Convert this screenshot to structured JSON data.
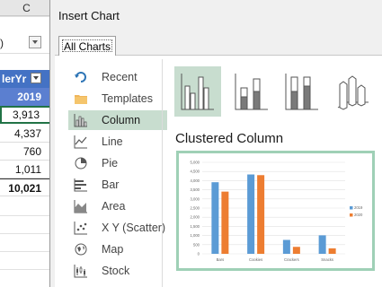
{
  "sheet": {
    "column_letter": "C",
    "filter_label": ")",
    "header_label": "lerYr",
    "year_label": "2019",
    "values": [
      "3,913",
      "4,337",
      "760",
      "1,011"
    ],
    "total": "10,021"
  },
  "dialog": {
    "title": "Insert Chart",
    "tab_label": "All Charts",
    "chart_types": [
      {
        "label": "Recent",
        "icon": "recent-icon"
      },
      {
        "label": "Templates",
        "icon": "folder-icon"
      },
      {
        "label": "Column",
        "icon": "column-chart-icon"
      },
      {
        "label": "Line",
        "icon": "line-chart-icon"
      },
      {
        "label": "Pie",
        "icon": "pie-chart-icon"
      },
      {
        "label": "Bar",
        "icon": "bar-chart-icon"
      },
      {
        "label": "Area",
        "icon": "area-chart-icon"
      },
      {
        "label": "X Y (Scatter)",
        "icon": "scatter-chart-icon"
      },
      {
        "label": "Map",
        "icon": "map-icon"
      },
      {
        "label": "Stock",
        "icon": "stock-chart-icon"
      }
    ],
    "selected_type": "Column",
    "subtypes": [
      "clustered-column",
      "stacked-column",
      "100-stacked-column",
      "3d-column"
    ],
    "selected_subtype_label": "Clustered Column",
    "accent_color": "#c8ddcf"
  },
  "chart_data": {
    "type": "bar",
    "categories": [
      "Bars",
      "Cookies",
      "Crackers",
      "Snacks"
    ],
    "series": [
      {
        "name": "2019",
        "values": [
          3913,
          4337,
          760,
          1011
        ],
        "color": "#5b9bd5"
      },
      {
        "name": "2020",
        "values": [
          3400,
          4300,
          380,
          300
        ],
        "color": "#ed7d31"
      }
    ],
    "yticks": [
      "0",
      "500",
      "1,000",
      "1,500",
      "2,000",
      "2,500",
      "3,000",
      "3,500",
      "4,000",
      "4,500",
      "5,000"
    ],
    "ylim": [
      0,
      5000
    ],
    "grid": true,
    "legend_position": "right"
  }
}
